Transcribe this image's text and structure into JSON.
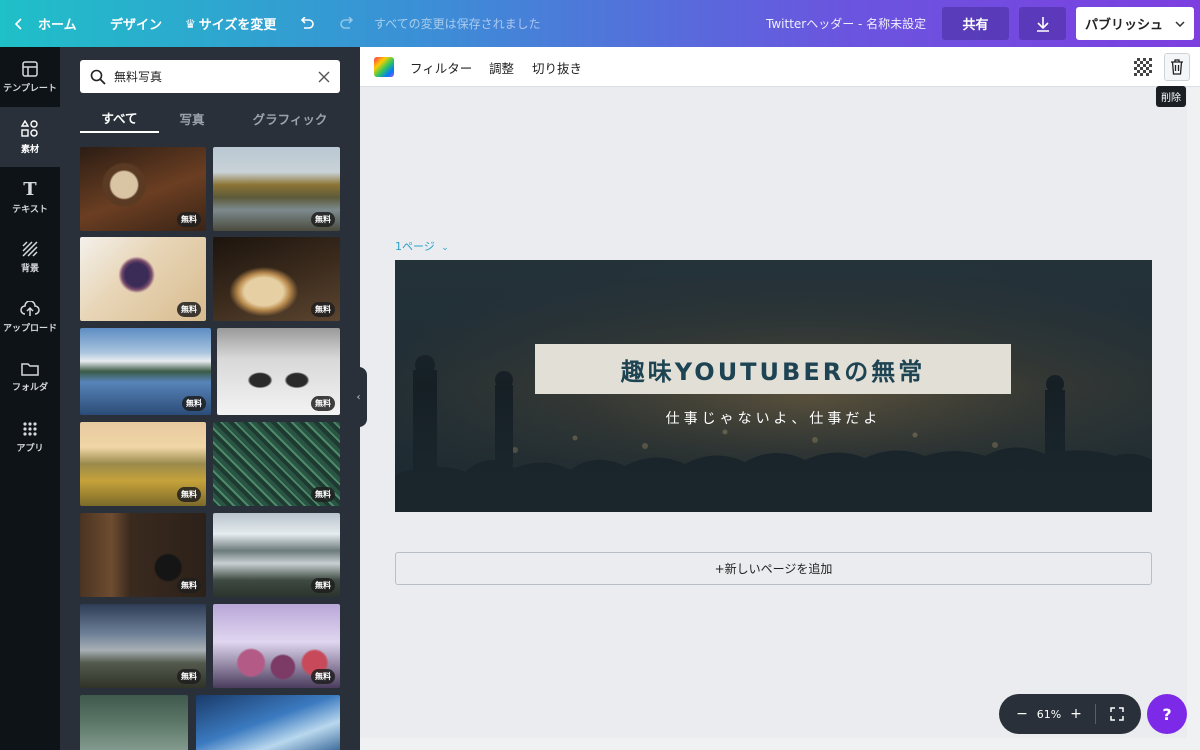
{
  "topbar": {
    "home": "ホーム",
    "design": "デザイン",
    "resize": "サイズを変更",
    "save_status": "すべての変更は保存されました",
    "doc_title": "Twitterヘッダー - 名称未設定",
    "share": "共有",
    "publish": "パブリッシュ"
  },
  "nav": {
    "templates": "テンプレート",
    "elements": "素材",
    "text": "テキスト",
    "background": "背景",
    "upload": "アップロード",
    "folder": "フォルダ",
    "apps": "アプリ"
  },
  "panel": {
    "search_value": "無料写真",
    "tabs": [
      "すべて",
      "写真",
      "グラフィック"
    ],
    "badge": "無料",
    "thumbnails": [
      "coffee-photo",
      "lake-road-photo",
      "salad-bowl-photo",
      "bread-photo",
      "mountain-lake-photo",
      "boots-photo",
      "balloons-valley-photo",
      "fern-photo",
      "desk-items-photo",
      "mountain-valley-photo",
      "road-field-photo",
      "berries-photo",
      "forest-photo",
      "wave-photo"
    ]
  },
  "toolbar": {
    "filter": "フィルター",
    "adjust": "調整",
    "crop": "切り抜き",
    "delete_tooltip": "削除"
  },
  "canvas": {
    "page_label": "1ページ",
    "title": "趣味YOUTUBERの無常",
    "subtitle": "仕事じゃないよ、仕事だよ",
    "add_page": "+新しいページを追加"
  },
  "zoom": {
    "level": "61%"
  },
  "help": "?",
  "colors": {
    "accent": "#7d2ae8",
    "title_text": "#1e4454",
    "title_box": "#e2e0d6",
    "page_label": "#27a3c6"
  }
}
